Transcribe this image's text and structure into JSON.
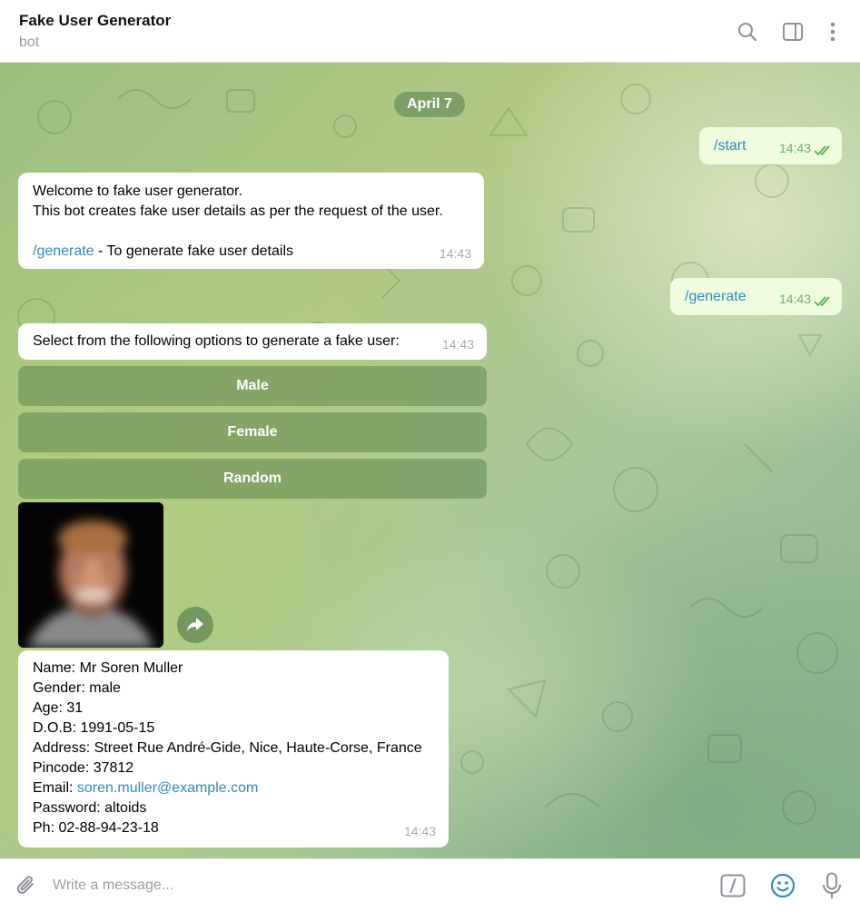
{
  "header": {
    "title": "Fake User Generator",
    "subtitle": "bot",
    "icons": [
      "search-icon",
      "sidebar-toggle-icon",
      "more-vertical-icon"
    ]
  },
  "chat": {
    "date": "April 7",
    "messages": {
      "start": {
        "text": "/start",
        "time": "14:43",
        "status": "read"
      },
      "welcome": {
        "line1": "Welcome to fake user generator.",
        "line2": "This bot creates fake user details as per the request of the user.",
        "command": "/generate",
        "command_desc": " - To generate fake user details",
        "time": "14:43"
      },
      "generate": {
        "text": "/generate",
        "time": "14:43",
        "status": "read"
      },
      "select": {
        "text": "Select from the following options to generate a fake user:",
        "time": "14:43"
      },
      "buttons": [
        "Male",
        "Female",
        "Random"
      ],
      "user_details": {
        "name": "Name: Mr Soren Muller",
        "gender": "Gender: male",
        "age": "Age: 31",
        "dob": "D.O.B: 1991-05-15",
        "address": "Address: Street Rue André-Gide, Nice, Haute-Corse, France",
        "pincode": "Pincode: 37812",
        "email_label": "Email: ",
        "email": "soren.muller@example.com",
        "password": "Password: altoids",
        "phone": "Ph: 02-88-94-23-18",
        "time": "14:43"
      }
    }
  },
  "composer": {
    "placeholder": "Write a message...",
    "icons": [
      "attach-icon",
      "bot-commands-icon",
      "emoji-icon",
      "microphone-icon"
    ]
  },
  "colors": {
    "accent": "#2f8bc4",
    "outgoing_bubble": "#effdde",
    "read_ticks": "#4fae4e"
  }
}
